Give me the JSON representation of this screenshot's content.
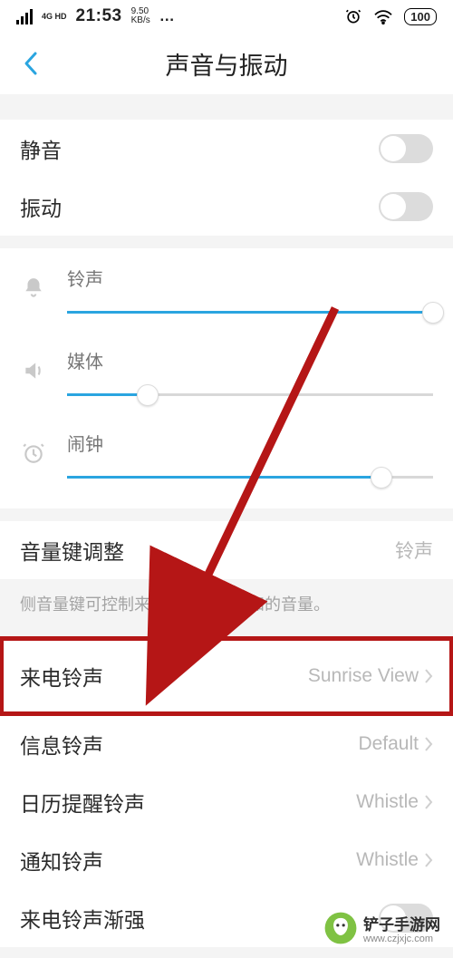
{
  "status": {
    "net": "4G HD",
    "time": "21:53",
    "kbs_top": "9.50",
    "kbs_bot": "KB/s",
    "battery": "100"
  },
  "header": {
    "title": "声音与振动"
  },
  "toggles": {
    "mute": {
      "label": "静音",
      "on": false
    },
    "vibrate": {
      "label": "振动",
      "on": false
    }
  },
  "sliders": {
    "ringtone": {
      "label": "铃声",
      "value": 100
    },
    "media": {
      "label": "媒体",
      "value": 22
    },
    "alarm": {
      "label": "闹钟",
      "value": 86
    }
  },
  "volume_key": {
    "label": "音量键调整",
    "value": "铃声",
    "note": "侧音量键可控制来电、信息和通知的音量。"
  },
  "ringtones": {
    "incoming": {
      "label": "来电铃声",
      "value": "Sunrise View"
    },
    "message": {
      "label": "信息铃声",
      "value": "Default"
    },
    "calendar": {
      "label": "日历提醒铃声",
      "value": "Whistle"
    },
    "notification": {
      "label": "通知铃声",
      "value": "Whistle"
    },
    "crescendo": {
      "label": "来电铃声渐强",
      "on": false
    }
  },
  "watermark": {
    "name": "铲子手游网",
    "url": "www.czjxjc.com"
  }
}
